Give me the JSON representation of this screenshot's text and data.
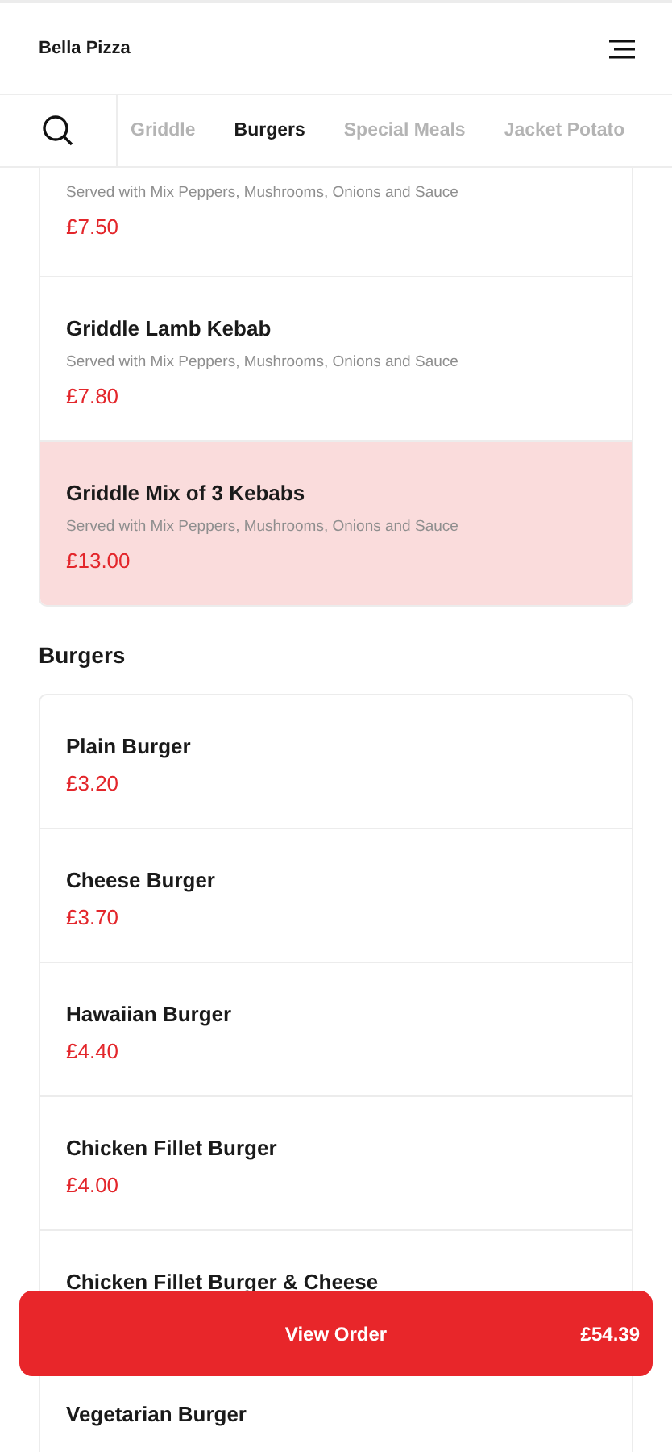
{
  "header": {
    "title": "Bella Pizza"
  },
  "tabs": [
    {
      "label": "Griddle",
      "selected": false
    },
    {
      "label": "Burgers",
      "selected": true
    },
    {
      "label": "Special Meals",
      "selected": false
    },
    {
      "label": "Jacket Potato",
      "selected": false
    }
  ],
  "sections": [
    {
      "items": [
        {
          "description": "Served with Mix Peppers, Mushrooms, Onions and Sauce",
          "price": "£7.50",
          "selected": false
        },
        {
          "name": "Griddle Lamb Kebab",
          "description": "Served with Mix Peppers, Mushrooms, Onions and Sauce",
          "price": "£7.80",
          "selected": false
        },
        {
          "name": "Griddle Mix of 3 Kebabs",
          "description": "Served with Mix Peppers, Mushrooms, Onions and Sauce",
          "price": "£13.00",
          "selected": true
        }
      ]
    },
    {
      "title": "Burgers",
      "items": [
        {
          "name": "Plain Burger",
          "price": "£3.20",
          "selected": false
        },
        {
          "name": "Cheese Burger",
          "price": "£3.70",
          "selected": false
        },
        {
          "name": "Hawaiian Burger",
          "price": "£4.40",
          "selected": false
        },
        {
          "name": "Chicken Fillet Burger",
          "price": "£4.00",
          "selected": false
        },
        {
          "name": "Chicken Fillet Burger & Cheese",
          "selected": false
        },
        {
          "name": "Vegetarian Burger",
          "selected": false
        }
      ]
    }
  ],
  "order_button": {
    "label": "View Order",
    "total": "£54.39"
  }
}
